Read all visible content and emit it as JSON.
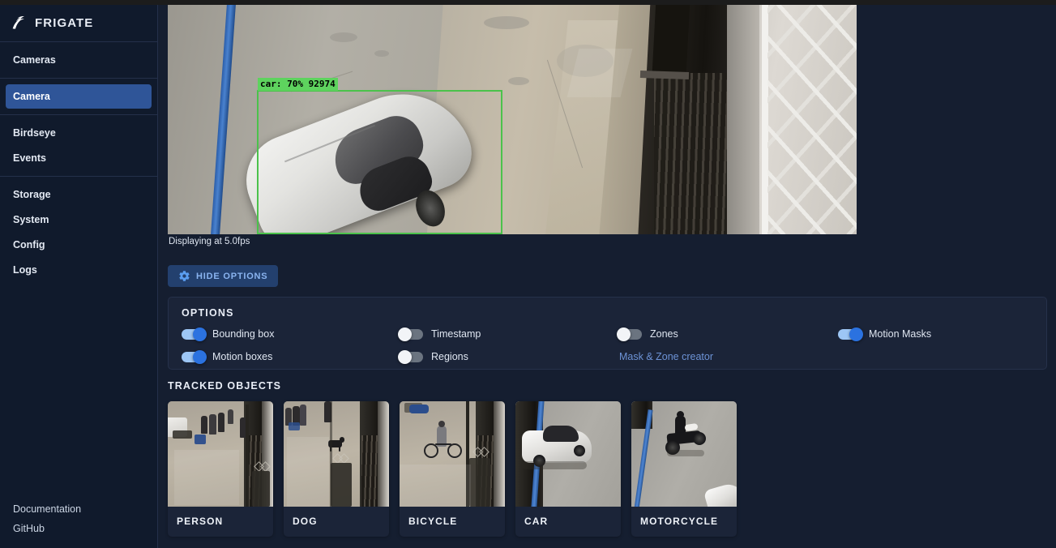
{
  "app": {
    "brand": "FRIGATE",
    "logo_icon": "frigate-bird-logo"
  },
  "sidebar": {
    "groups": [
      {
        "items": [
          {
            "label": "Cameras",
            "active": false
          }
        ]
      },
      {
        "items": [
          {
            "label": "Camera",
            "active": true
          }
        ]
      },
      {
        "items": [
          {
            "label": "Birdseye",
            "active": false
          },
          {
            "label": "Events",
            "active": false
          }
        ]
      },
      {
        "items": [
          {
            "label": "Storage",
            "active": false
          },
          {
            "label": "System",
            "active": false
          },
          {
            "label": "Config",
            "active": false
          },
          {
            "label": "Logs",
            "active": false
          }
        ]
      }
    ],
    "footer": [
      {
        "label": "Documentation"
      },
      {
        "label": "GitHub"
      }
    ]
  },
  "viewer": {
    "detection_label": "car: 70% 92974",
    "detection_box_color": "#4bc24b",
    "fps_text": "Displaying at 5.0fps"
  },
  "toolbar": {
    "hide_options_label": "HIDE OPTIONS",
    "gear_icon": "gear-icon"
  },
  "options": {
    "title": "OPTIONS",
    "toggles": [
      {
        "label": "Bounding box",
        "on": true
      },
      {
        "label": "Timestamp",
        "on": false
      },
      {
        "label": "Zones",
        "on": false
      },
      {
        "label": "Motion Masks",
        "on": true
      },
      {
        "label": "Motion boxes",
        "on": true
      },
      {
        "label": "Regions",
        "on": false
      }
    ],
    "link_label": "Mask & Zone creator",
    "link_color": "#6d93d6",
    "toggle_on_track_color": "#9dc6f5",
    "toggle_on_knob_color": "#2b72e0",
    "toggle_off_track_color": "#6b7480",
    "toggle_off_knob_color": "#f2f4f7"
  },
  "tracked_objects": {
    "title": "TRACKED OBJECTS",
    "cards": [
      {
        "label": "PERSON"
      },
      {
        "label": "DOG"
      },
      {
        "label": "BICYCLE"
      },
      {
        "label": "CAR"
      },
      {
        "label": "MOTORCYCLE"
      }
    ]
  },
  "colors": {
    "sidebar_bg": "#101a2c",
    "main_bg": "#151e30",
    "panel_bg": "#1b2438",
    "active_nav": "#2f5598",
    "button_bg": "#23406e",
    "button_text": "#8ab4f0"
  }
}
